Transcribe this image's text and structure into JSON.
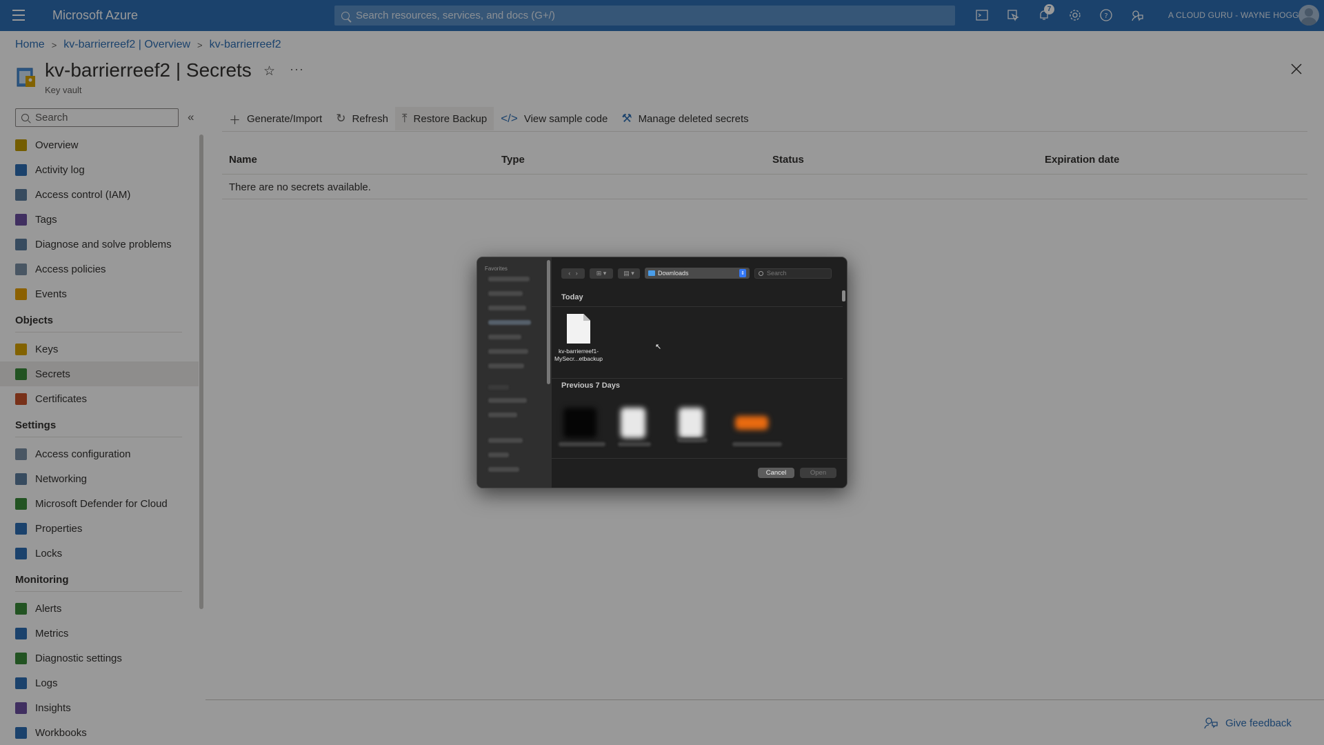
{
  "topbar": {
    "brand": "Microsoft Azure",
    "search_placeholder": "Search resources, services, and docs (G+/)",
    "notification_count": "7",
    "account": "A CLOUD GURU - WAYNE HOGG...",
    "icons": [
      "cloud-shell-icon",
      "directory-filter-icon",
      "notifications-icon",
      "settings-icon",
      "help-icon",
      "feedback-icon"
    ]
  },
  "breadcrumb": [
    "Home",
    "kv-barrierreef2 | Overview",
    "kv-barrierreef2"
  ],
  "page": {
    "title": "kv-barrierreef2 | Secrets",
    "subtitle": "Key vault",
    "more": "···"
  },
  "sidebar": {
    "search_placeholder": "Search",
    "collapse": "«",
    "items_top": [
      {
        "label": "Overview",
        "icon": "overview-icon",
        "color": "#c19c00"
      },
      {
        "label": "Activity log",
        "icon": "activity-log-icon",
        "color": "#2d6fb5"
      },
      {
        "label": "Access control (IAM)",
        "icon": "iam-icon",
        "color": "#5c7e9e"
      },
      {
        "label": "Tags",
        "icon": "tags-icon",
        "color": "#6b4fa0"
      },
      {
        "label": "Diagnose and solve problems",
        "icon": "diagnose-icon",
        "color": "#5c7e9e"
      },
      {
        "label": "Access policies",
        "icon": "access-policies-icon",
        "color": "#7a8fa6"
      },
      {
        "label": "Events",
        "icon": "events-icon",
        "color": "#e8a100"
      }
    ],
    "sections": {
      "objects": "Objects",
      "settings": "Settings",
      "monitoring": "Monitoring"
    },
    "items_objects": [
      {
        "label": "Keys",
        "icon": "key-icon",
        "color": "#d9a300"
      },
      {
        "label": "Secrets",
        "icon": "secrets-icon",
        "color": "#3a8a3a"
      },
      {
        "label": "Certificates",
        "icon": "certificates-icon",
        "color": "#c8532a"
      }
    ],
    "items_settings": [
      {
        "label": "Access configuration",
        "icon": "access-config-icon",
        "color": "#7a8fa6"
      },
      {
        "label": "Networking",
        "icon": "networking-icon",
        "color": "#5c7e9e"
      },
      {
        "label": "Microsoft Defender for Cloud",
        "icon": "defender-icon",
        "color": "#3a8a3a"
      },
      {
        "label": "Properties",
        "icon": "properties-icon",
        "color": "#2d6fb5"
      },
      {
        "label": "Locks",
        "icon": "locks-icon",
        "color": "#2d6fb5"
      }
    ],
    "items_monitoring": [
      {
        "label": "Alerts",
        "icon": "alerts-icon",
        "color": "#3a8a3a"
      },
      {
        "label": "Metrics",
        "icon": "metrics-icon",
        "color": "#2d6fb5"
      },
      {
        "label": "Diagnostic settings",
        "icon": "diagnostic-settings-icon",
        "color": "#3a8a3a"
      },
      {
        "label": "Logs",
        "icon": "logs-icon",
        "color": "#2d6fb5"
      },
      {
        "label": "Insights",
        "icon": "insights-icon",
        "color": "#6b4fa0"
      },
      {
        "label": "Workbooks",
        "icon": "workbooks-icon",
        "color": "#2d6fb5"
      }
    ]
  },
  "toolbar": {
    "generate": "Generate/Import",
    "refresh": "Refresh",
    "restore": "Restore Backup",
    "sample": "View sample code",
    "deleted": "Manage deleted secrets"
  },
  "table": {
    "headers": [
      "Name",
      "Type",
      "Status",
      "Expiration date"
    ],
    "empty_message": "There are no secrets available."
  },
  "footer": {
    "feedback": "Give feedback"
  },
  "file_dialog": {
    "sidebar_heading": "Favorites",
    "folder": "Downloads",
    "search_placeholder": "Search",
    "group_today": "Today",
    "group_previous": "Previous 7 Days",
    "today_file_name_line1": "kv-barrierreef1-",
    "today_file_name_line2": "MySecr...etbackup",
    "cancel": "Cancel",
    "open": "Open"
  }
}
